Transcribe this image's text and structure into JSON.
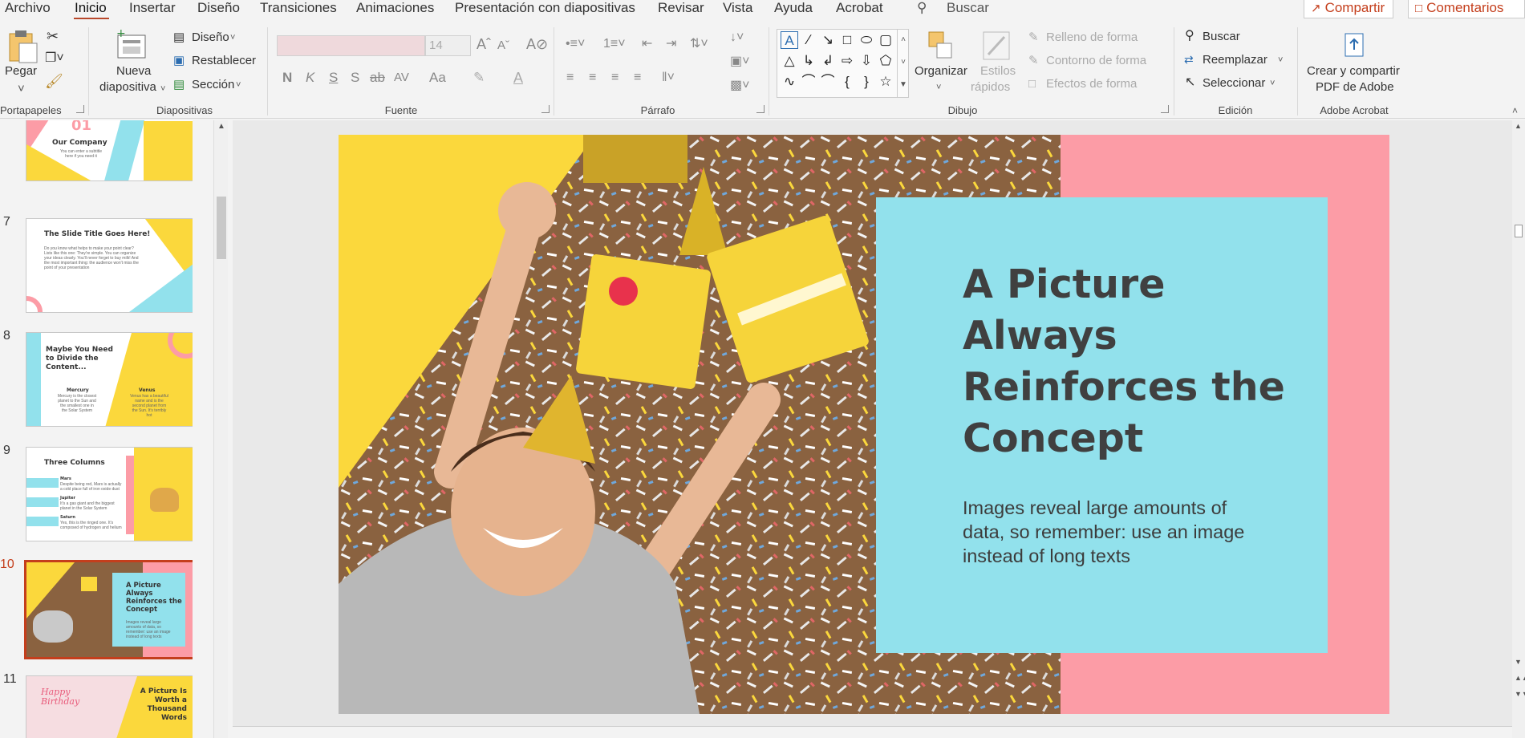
{
  "menu": {
    "items": [
      "Archivo",
      "Inicio",
      "Insertar",
      "Diseño",
      "Transiciones",
      "Animaciones",
      "Presentación con diapositivas",
      "Revisar",
      "Vista",
      "Ayuda",
      "Acrobat"
    ],
    "active": "Inicio",
    "search_label": "Buscar",
    "share_label": "Compartir",
    "comments_label": "Comentarios"
  },
  "ribbon": {
    "portapapeles": {
      "paste_label": "Pegar",
      "group_label": "Portapapeles"
    },
    "diapositivas": {
      "new_slide_line1": "Nueva",
      "new_slide_line2": "diapositiva",
      "design_label": "Diseño",
      "reset_label": "Restablecer",
      "section_label": "Sección",
      "group_label": "Diapositivas"
    },
    "fuente": {
      "font_size": "14",
      "group_label": "Fuente",
      "bold": "N",
      "italic": "K",
      "underline": "S",
      "shadow": "S",
      "strike": "ab",
      "spacing": "AV",
      "case": "Aa"
    },
    "parrafo": {
      "group_label": "Párrafo"
    },
    "dibujo": {
      "organize_label": "Organizar",
      "styles_line1": "Estilos",
      "styles_line2": "rápidos",
      "fill_label": "Relleno de forma",
      "outline_label": "Contorno de forma",
      "effects_label": "Efectos de forma",
      "group_label": "Dibujo"
    },
    "edicion": {
      "find_label": "Buscar",
      "replace_label": "Reemplazar",
      "select_label": "Seleccionar",
      "group_label": "Edición"
    },
    "acrobat": {
      "create_line1": "Crear y compartir",
      "create_line2": "PDF de Adobe",
      "group_label": "Adobe Acrobat"
    }
  },
  "thumbnails": [
    {
      "num": "",
      "title": "Our Company",
      "number_text": "01",
      "body": "You can enter a subtitle here if you need it"
    },
    {
      "num": "7",
      "title": "The Slide Title Goes Here!",
      "body": "Do you know what helps to make your point clear? Lists like this one: They're simple. You can organize your ideas clearly. You'll never forget to buy milk! And the most important thing: the audience won't miss the point of your presentation"
    },
    {
      "num": "8",
      "title": "Maybe You Need to Divide the Content...",
      "col1_title": "Mercury",
      "col1_body": "Mercury is the closest planet to the Sun and the smallest one in the Solar System",
      "col2_title": "Venus",
      "col2_body": "Venus has a beautiful name and is the second planet from the Sun. It's terribly hot"
    },
    {
      "num": "9",
      "title": "Three Columns",
      "items": [
        {
          "title": "Mars",
          "body": "Despite being red, Mars is actually a cold place full of iron oxide dust"
        },
        {
          "title": "Jupiter",
          "body": "It's a gas giant and the biggest planet in the Solar System"
        },
        {
          "title": "Saturn",
          "body": "Yes, this is the ringed one. It's composed of hydrogen and helium"
        }
      ]
    },
    {
      "num": "10",
      "title": "A Picture Always Reinforces the Concept",
      "body": "Images reveal large amounts of data, so remember: use an image instead of long texts"
    },
    {
      "num": "11",
      "title": "A Picture Is Worth a Thousand Words",
      "script_text": "Happy Birthday"
    }
  ],
  "slide": {
    "title": "A Picture Always Reinforces the Concept",
    "body": "Images reveal large amounts of data, so remember: use an image instead of long texts"
  },
  "colors": {
    "accent": "#c43e1c",
    "pink": "#fc9ca6",
    "cyan": "#92e1ec",
    "yellow": "#fbd83c",
    "title_text": "#404040"
  }
}
